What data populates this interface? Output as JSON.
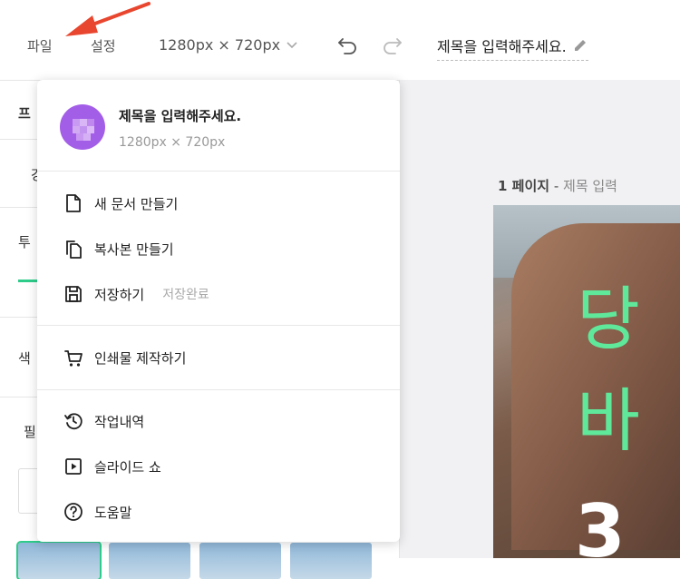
{
  "topbar": {
    "menu_file": "파일",
    "menu_settings": "설정",
    "size_value": "1280px × 720px",
    "doc_title": "제목을 입력해주세요."
  },
  "left_panel": {
    "partial_texts": [
      "프",
      "강",
      "투",
      "색",
      "필"
    ]
  },
  "canvas": {
    "page_number": "1 페이지",
    "page_separator": " - ",
    "page_title": "제목 입력",
    "slide_text_line1": "당",
    "slide_text_line2": "바",
    "slide_text_line3": "3"
  },
  "dropdown": {
    "title": "제목을 입력해주세요.",
    "size": "1280px × 720px",
    "items": [
      {
        "label": "새 문서 만들기",
        "icon": "new-document-icon"
      },
      {
        "label": "복사본 만들기",
        "icon": "copy-icon"
      },
      {
        "label": "저장하기",
        "icon": "save-icon",
        "status": "저장완료"
      },
      {
        "label": "인쇄물 제작하기",
        "icon": "cart-icon"
      },
      {
        "label": "작업내역",
        "icon": "history-icon"
      },
      {
        "label": "슬라이드 쇼",
        "icon": "slideshow-icon"
      },
      {
        "label": "도움말",
        "icon": "help-icon"
      }
    ]
  },
  "colors": {
    "accent_green": "#2ecc8a",
    "slide_text_green": "#5fe89a",
    "avatar_purple": "#a35ee8",
    "annotation_red": "#e8462e"
  }
}
